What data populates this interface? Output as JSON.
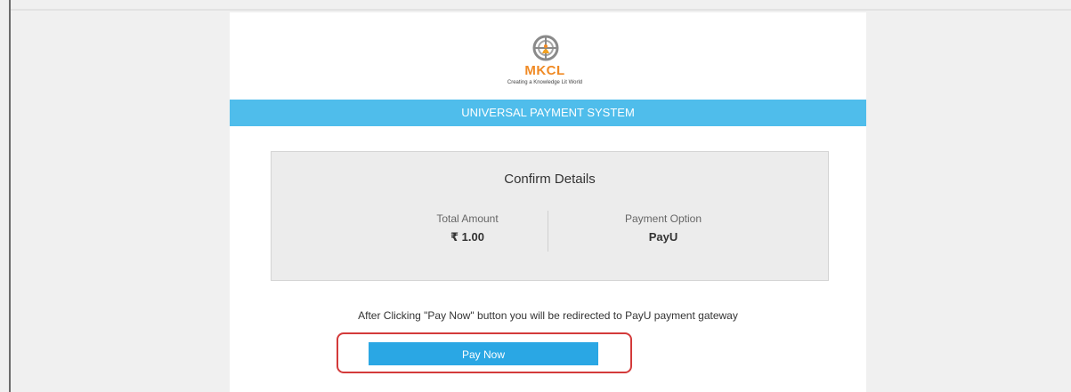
{
  "header": {
    "logo_name": "MKCL",
    "logo_tagline": "Creating a Knowledge Lit World",
    "banner_title": "UNIVERSAL PAYMENT SYSTEM"
  },
  "confirm": {
    "title": "Confirm Details",
    "total_amount_label": "Total Amount",
    "total_amount_value": "₹  1.00",
    "payment_option_label": "Payment Option",
    "payment_option_value": "PayU"
  },
  "footer": {
    "redirect_message": "After Clicking \"Pay Now\" button you will be redirected to PayU payment gateway",
    "pay_button_label": "Pay Now"
  },
  "colors": {
    "banner": "#4fbdeb",
    "button": "#2aa7e4",
    "logo_orange": "#f08a24",
    "highlight": "#d33a3a"
  }
}
